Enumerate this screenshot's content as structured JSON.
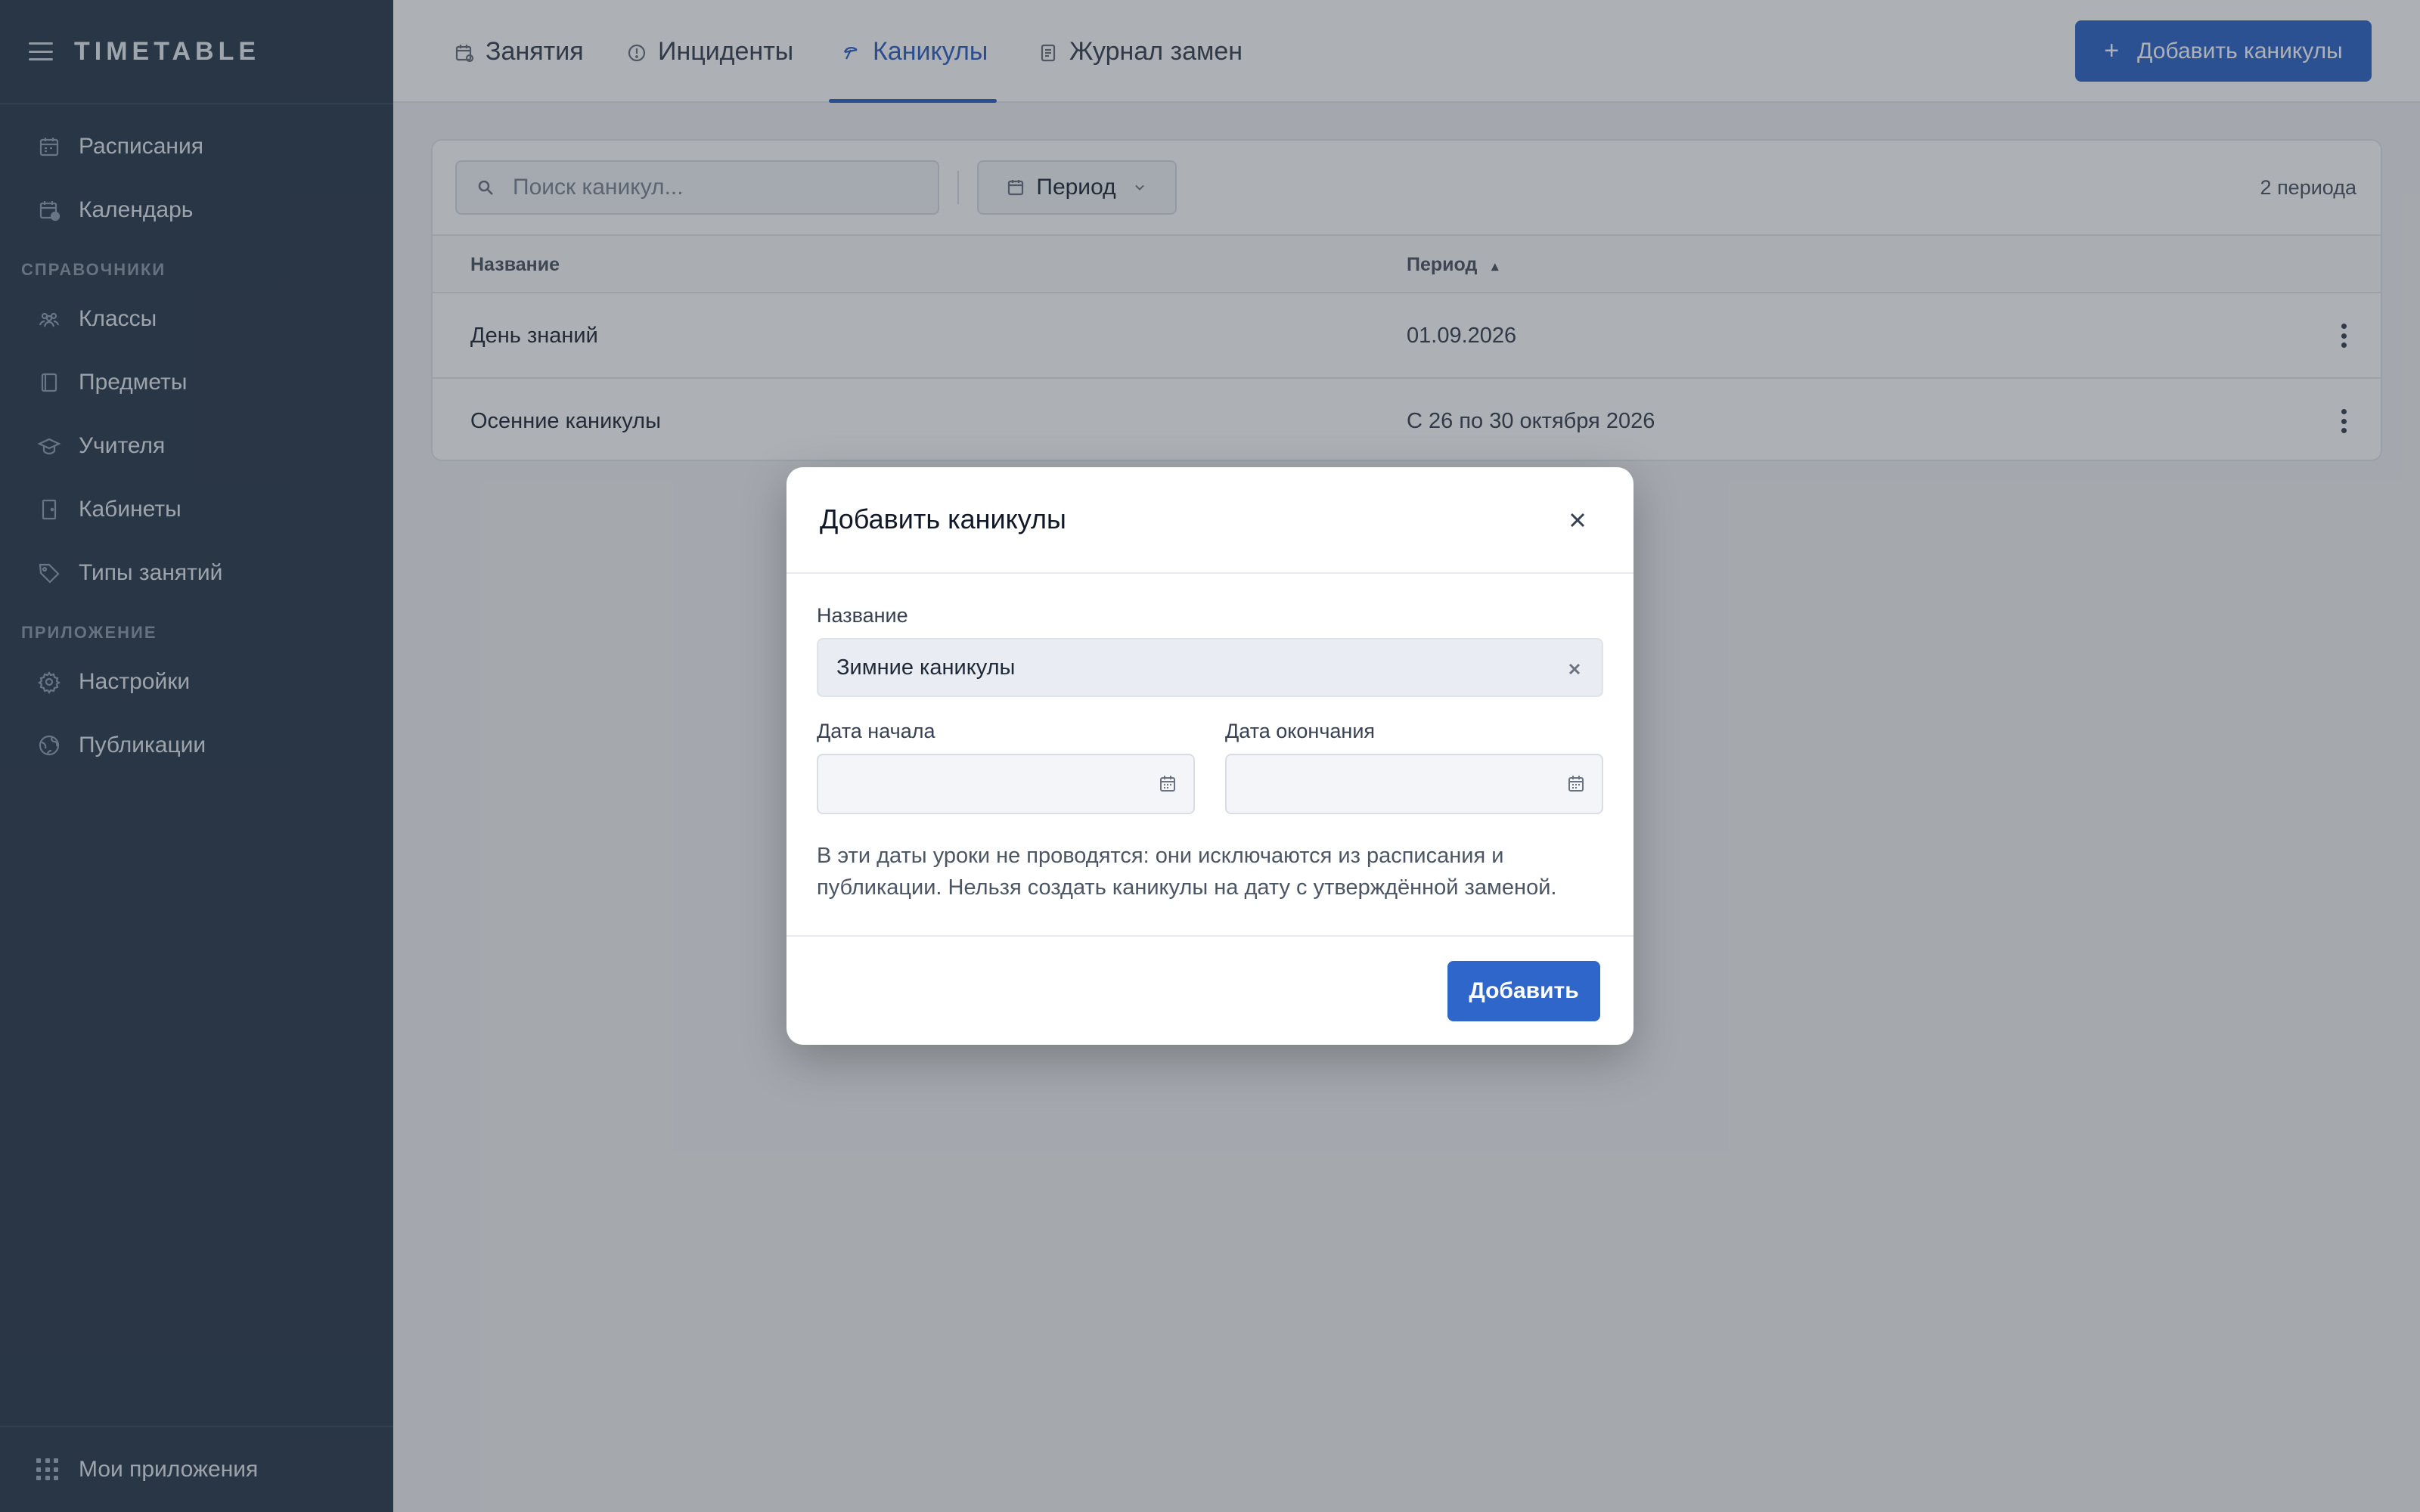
{
  "app": {
    "logo": "TIMETABLE"
  },
  "sidebar": {
    "items_top": [
      {
        "label": "Расписания",
        "icon": "calendar-grid-icon"
      },
      {
        "label": "Календарь",
        "icon": "calendar-clock-icon"
      }
    ],
    "section_refs": "СПРАВОЧНИКИ",
    "items_refs": [
      {
        "label": "Классы",
        "icon": "group-icon"
      },
      {
        "label": "Предметы",
        "icon": "book-icon"
      },
      {
        "label": "Учителя",
        "icon": "graduation-cap-icon"
      },
      {
        "label": "Кабинеты",
        "icon": "door-icon"
      },
      {
        "label": "Типы занятий",
        "icon": "tag-icon"
      }
    ],
    "section_app": "ПРИЛОЖЕНИЕ",
    "items_app": [
      {
        "label": "Настройки",
        "icon": "gear-icon"
      },
      {
        "label": "Публикации",
        "icon": "globe-icon"
      }
    ],
    "footer": {
      "label": "Мои приложения",
      "icon": "apps-grid-icon"
    }
  },
  "tabs": [
    {
      "label": "Занятия",
      "icon": "calendar-lesson-icon",
      "active": false
    },
    {
      "label": "Инциденты",
      "icon": "alert-circle-icon",
      "active": false
    },
    {
      "label": "Каникулы",
      "icon": "umbrella-icon",
      "active": true
    },
    {
      "label": "Журнал замен",
      "icon": "journal-icon",
      "active": false
    }
  ],
  "header": {
    "add_button_label": "Добавить каникулы",
    "add_button_icon": "plus-icon"
  },
  "toolbar": {
    "search_placeholder": "Поиск каникул...",
    "period_label": "Период",
    "count_text": "2 периода"
  },
  "table": {
    "columns": [
      "Название",
      "Период"
    ],
    "sort_indicator": "▴",
    "rows": [
      {
        "name": "День знаний",
        "period": "01.09.2026"
      },
      {
        "name": "Осенние каникулы",
        "period": "С 26 по 30 октября 2026"
      }
    ]
  },
  "modal": {
    "title": "Добавить каникулы",
    "name_label": "Название",
    "name_value": "Зимние каникулы",
    "start_label": "Дата начала",
    "start_value": "",
    "end_label": "Дата окончания",
    "end_value": "",
    "hint": "В эти даты уроки не проводятся: они исключаются из расписания и публикации. Нельзя создать каникулы на дату с утверждённой заменой.",
    "submit_label": "Добавить"
  },
  "colors": {
    "accent": "#2f66c9",
    "sidebar_bg": "#2b3a4e",
    "overlay": "rgba(40,48,58,0.38)"
  }
}
